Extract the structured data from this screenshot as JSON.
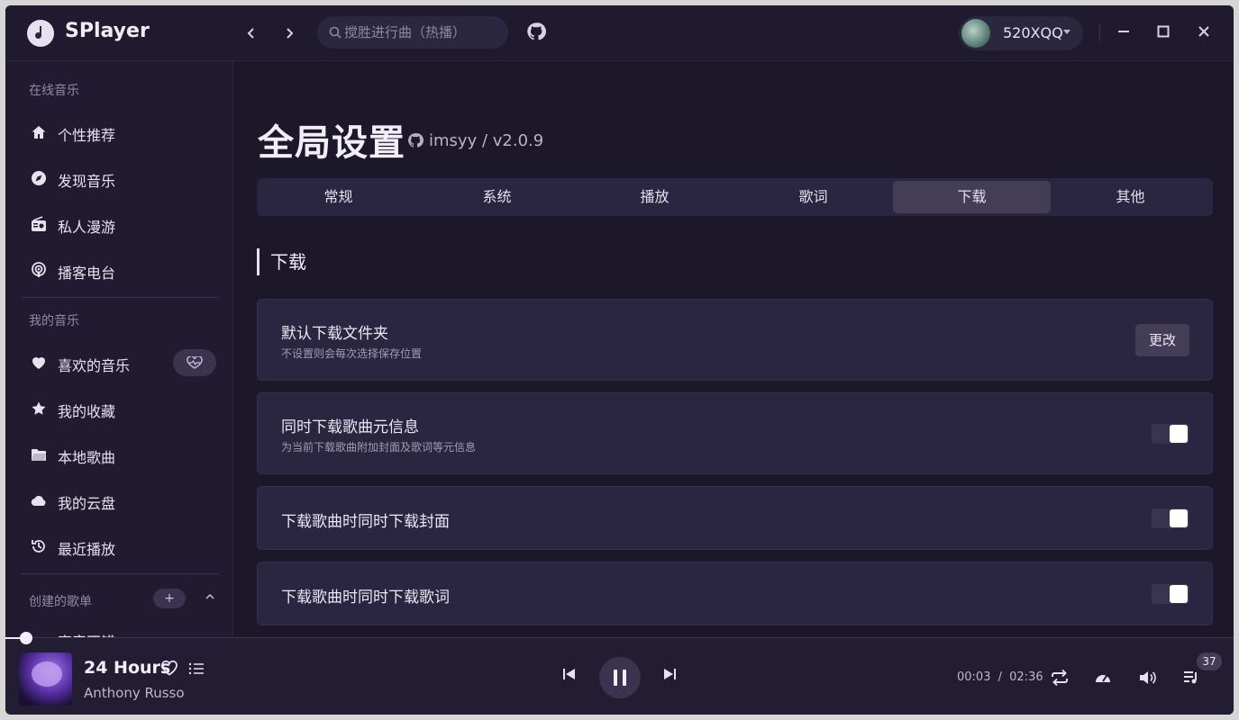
{
  "app": {
    "name": "SPlayer",
    "search_placeholder": "搅胜进行曲（热播）",
    "user_name": "520XQQ"
  },
  "sidebar": {
    "online_title": "在线音乐",
    "online_items": [
      {
        "label": "个性推荐",
        "icon": "home-icon"
      },
      {
        "label": "发现音乐",
        "icon": "compass-icon"
      },
      {
        "label": "私人漫游",
        "icon": "radio-icon"
      },
      {
        "label": "播客电台",
        "icon": "podcast-icon"
      }
    ],
    "mine_title": "我的音乐",
    "mine_items": [
      {
        "label": "喜欢的音乐",
        "icon": "heart-icon"
      },
      {
        "label": "我的收藏",
        "icon": "star-icon"
      },
      {
        "label": "本地歌曲",
        "icon": "folder-icon"
      },
      {
        "label": "我的云盘",
        "icon": "cloud-icon"
      },
      {
        "label": "最近播放",
        "icon": "history-icon"
      }
    ],
    "created_title": "创建的歌单",
    "add_label": "+",
    "partial_item": "声音不错"
  },
  "main": {
    "title": "全局设置",
    "repo_owner": "imsyy",
    "repo_sep": "/",
    "version": "v2.0.9",
    "tabs": [
      {
        "label": "常规",
        "active": false
      },
      {
        "label": "系统",
        "active": false
      },
      {
        "label": "播放",
        "active": false
      },
      {
        "label": "歌词",
        "active": false
      },
      {
        "label": "下载",
        "active": true
      },
      {
        "label": "其他",
        "active": false
      }
    ],
    "section_title": "下载",
    "settings": [
      {
        "title": "默认下载文件夹",
        "desc": "不设置则会每次选择保存位置",
        "control": "button",
        "button_label": "更改"
      },
      {
        "title": "同时下载歌曲元信息",
        "desc": "为当前下载歌曲附加封面及歌词等元信息",
        "control": "toggle",
        "on": true
      },
      {
        "title": "下载歌曲时同时下载封面",
        "desc": "",
        "control": "toggle",
        "on": true
      },
      {
        "title": "下载歌曲时同时下载歌词",
        "desc": "",
        "control": "toggle",
        "on": true
      }
    ]
  },
  "player": {
    "song": "24 Hours",
    "artist": "Anthony Russo",
    "current_time": "00:03",
    "time_sep": "/",
    "duration": "02:36",
    "queue_count": "37"
  },
  "colors": {
    "background": "#1c1829",
    "card": "#2a2540",
    "accent": "#f2eef8"
  }
}
